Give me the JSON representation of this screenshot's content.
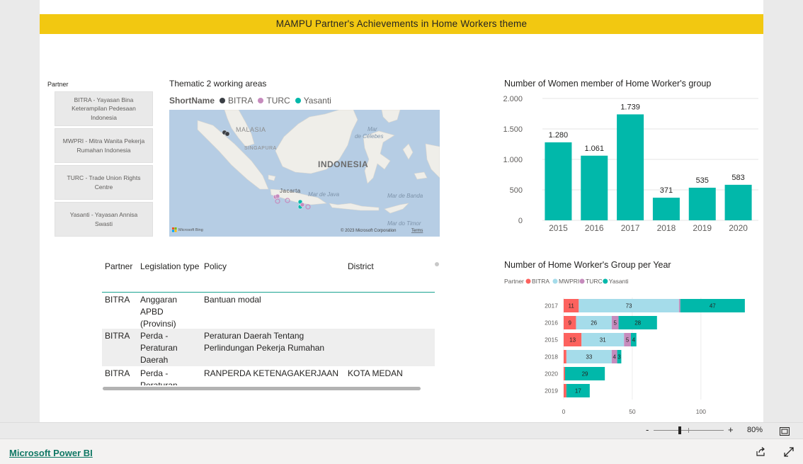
{
  "report": {
    "title": "MAMPU Partner's Achievements in Home Workers theme"
  },
  "slicer": {
    "label": "Partner",
    "items": [
      {
        "label": "BITRA - Yayasan Bina Keterampilan Pedesaan Indonesia"
      },
      {
        "label": "MWPRI - Mitra Wanita Pekerja Rumahan Indonesia"
      },
      {
        "label": "TURC - Trade Union Rights Centre"
      },
      {
        "label": "Yasanti - Yayasan Annisa Swasti"
      }
    ]
  },
  "map": {
    "title": "Thematic 2 working areas",
    "legend_title": "ShortName",
    "legend": [
      {
        "name": "BITRA",
        "color": "#3b3f45"
      },
      {
        "name": "TURC",
        "color": "#c68bbd"
      },
      {
        "name": "Yasanti",
        "color": "#01b8aa"
      }
    ],
    "labels": {
      "malaysia": "MALASIA",
      "singapore": "SINGAPURA",
      "indonesia": "INDONESIA",
      "jakarta": "Jacarta",
      "celebes": "Mar de Célebes",
      "java": "Mar de Java",
      "banda": "Mar de Banda",
      "timor": "Mar do Timor"
    },
    "attribution_logo": "Microsoft Bing",
    "attribution": "© 2023 Microsoft Corporation",
    "terms": "Terms"
  },
  "table": {
    "headers": [
      "Partner",
      "Legislation type",
      "Policy",
      "District"
    ],
    "rows": [
      [
        "BITRA",
        "Anggaran APBD (Provinsi)",
        "Bantuan modal",
        ""
      ],
      [
        "BITRA",
        "Perda - Peraturan Daerah",
        "Peraturan Daerah Tentang Perlindungan Pekerja Rumahan",
        ""
      ],
      [
        "BITRA",
        "Perda - Peraturan",
        "RANPERDA KETENAGAKERJAAN",
        "KOTA MEDAN"
      ]
    ]
  },
  "chart1_title": "Number of Women member of Home Worker's group",
  "chart2_title": "Number of Home Worker's Group per Year",
  "chart2_legend_title": "Partner",
  "chart_data": [
    {
      "type": "bar",
      "title": "Number of Women member of Home Worker's group",
      "categories": [
        "2015",
        "2016",
        "2017",
        "2018",
        "2019",
        "2020"
      ],
      "values": [
        1280,
        1061,
        1739,
        371,
        535,
        583
      ],
      "value_labels": [
        "1.280",
        "1.061",
        "1.739",
        "371",
        "535",
        "583"
      ],
      "ylim": [
        0,
        2000
      ],
      "yticks": [
        "0",
        "500",
        "1.000",
        "1.500",
        "2.000"
      ],
      "color": "#01b8aa",
      "grid": true
    },
    {
      "type": "bar",
      "orientation": "horizontal",
      "stacked": true,
      "title": "Number of Home Worker's Group per Year",
      "categories": [
        "2017",
        "2016",
        "2015",
        "2018",
        "2020",
        "2019"
      ],
      "series": [
        {
          "name": "BITRA",
          "color": "#fd625e",
          "values": [
            11,
            9,
            13,
            2,
            1,
            2
          ]
        },
        {
          "name": "MWPRI",
          "color": "#a5dcea",
          "values": [
            73,
            26,
            31,
            33,
            0,
            0
          ]
        },
        {
          "name": "TURC",
          "color": "#c68bbd",
          "values": [
            1,
            5,
            5,
            4,
            0,
            0
          ]
        },
        {
          "name": "Yasanti",
          "color": "#01b8aa",
          "values": [
            47,
            28,
            4,
            3,
            29,
            17
          ]
        }
      ],
      "xlim": [
        0,
        130
      ],
      "xticks": [
        "0",
        "50",
        "100"
      ],
      "legend_position": "top-left",
      "grid": true
    }
  ],
  "zoom": {
    "minus": "-",
    "plus": "+",
    "level": "80%"
  },
  "footer": {
    "brand_link": "Microsoft Power BI"
  }
}
